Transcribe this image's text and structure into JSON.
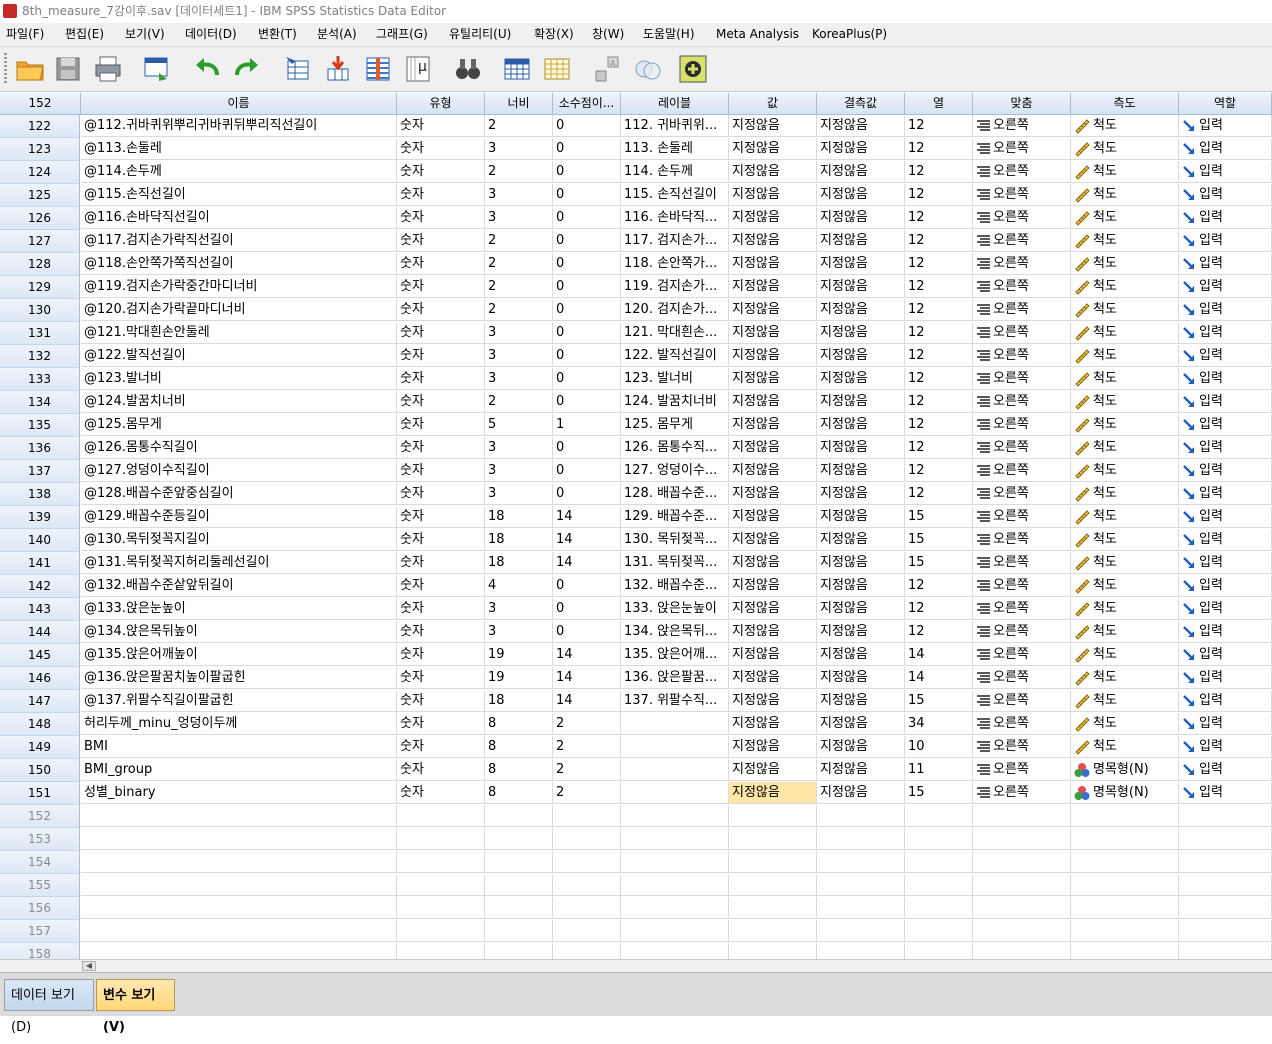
{
  "window": {
    "title": "8th_measure_7강이후.sav [데이터세트1] - IBM SPSS Statistics Data Editor",
    "accent": "#c62828"
  },
  "menu": [
    "파일(F)",
    "편집(E)",
    "보기(V)",
    "데이터(D)",
    "변환(T)",
    "분석(A)",
    "그래프(G)",
    "유틸리티(U)",
    "확장(X)",
    "창(W)",
    "도움말(H)",
    "Meta Analysis",
    "KoreaPlus(P)"
  ],
  "toolbar_icons": [
    "open-folder-icon",
    "save-icon",
    "print-icon",
    "dialog-recall-icon",
    "undo-icon",
    "redo-icon",
    "goto-case-icon",
    "goto-variable-icon",
    "variables-icon",
    "value-labels-icon",
    "find-icon",
    "split-file-icon",
    "weight-cases-icon",
    "select-cases-icon",
    "use-sets-icon",
    "add-variable-icon"
  ],
  "columns": [
    "이름",
    "유형",
    "너비",
    "소수점이...",
    "레이블",
    "값",
    "결측값",
    "열",
    "맞춤",
    "측도",
    "역할"
  ],
  "header_corner": "152",
  "rows": [
    {
      "n": "122",
      "name": "@112.귀바퀴위뿌리귀바퀴뒤뿌리직선길이",
      "type": "숫자",
      "width": "2",
      "dec": "0",
      "label": "112. 귀바퀴위...",
      "values": "지정않음",
      "missing": "지정않음",
      "cols": "12",
      "align": "오른쪽",
      "measure": "척도",
      "role": "입력"
    },
    {
      "n": "123",
      "name": "@113.손둘레",
      "type": "숫자",
      "width": "3",
      "dec": "0",
      "label": "113. 손둘레",
      "values": "지정않음",
      "missing": "지정않음",
      "cols": "12",
      "align": "오른쪽",
      "measure": "척도",
      "role": "입력"
    },
    {
      "n": "124",
      "name": "@114.손두께",
      "type": "숫자",
      "width": "2",
      "dec": "0",
      "label": "114. 손두께",
      "values": "지정않음",
      "missing": "지정않음",
      "cols": "12",
      "align": "오른쪽",
      "measure": "척도",
      "role": "입력"
    },
    {
      "n": "125",
      "name": "@115.손직선길이",
      "type": "숫자",
      "width": "3",
      "dec": "0",
      "label": "115. 손직선길이",
      "values": "지정않음",
      "missing": "지정않음",
      "cols": "12",
      "align": "오른쪽",
      "measure": "척도",
      "role": "입력"
    },
    {
      "n": "126",
      "name": "@116.손바닥직선길이",
      "type": "숫자",
      "width": "3",
      "dec": "0",
      "label": "116. 손바닥직...",
      "values": "지정않음",
      "missing": "지정않음",
      "cols": "12",
      "align": "오른쪽",
      "measure": "척도",
      "role": "입력"
    },
    {
      "n": "127",
      "name": "@117.검지손가락직선길이",
      "type": "숫자",
      "width": "2",
      "dec": "0",
      "label": "117. 검지손가...",
      "values": "지정않음",
      "missing": "지정않음",
      "cols": "12",
      "align": "오른쪽",
      "measure": "척도",
      "role": "입력"
    },
    {
      "n": "128",
      "name": "@118.손안쪽가쪽직선길이",
      "type": "숫자",
      "width": "2",
      "dec": "0",
      "label": "118. 손안쪽가...",
      "values": "지정않음",
      "missing": "지정않음",
      "cols": "12",
      "align": "오른쪽",
      "measure": "척도",
      "role": "입력"
    },
    {
      "n": "129",
      "name": "@119.검지손가락중간마디너비",
      "type": "숫자",
      "width": "2",
      "dec": "0",
      "label": "119. 검지손가...",
      "values": "지정않음",
      "missing": "지정않음",
      "cols": "12",
      "align": "오른쪽",
      "measure": "척도",
      "role": "입력"
    },
    {
      "n": "130",
      "name": "@120.검지손가락끝마디너비",
      "type": "숫자",
      "width": "2",
      "dec": "0",
      "label": "120. 검지손가...",
      "values": "지정않음",
      "missing": "지정않음",
      "cols": "12",
      "align": "오른쪽",
      "measure": "척도",
      "role": "입력"
    },
    {
      "n": "131",
      "name": "@121.막대흰손안둘레",
      "type": "숫자",
      "width": "3",
      "dec": "0",
      "label": "121. 막대흰손...",
      "values": "지정않음",
      "missing": "지정않음",
      "cols": "12",
      "align": "오른쪽",
      "measure": "척도",
      "role": "입력"
    },
    {
      "n": "132",
      "name": "@122.발직선길이",
      "type": "숫자",
      "width": "3",
      "dec": "0",
      "label": "122. 발직선길이",
      "values": "지정않음",
      "missing": "지정않음",
      "cols": "12",
      "align": "오른쪽",
      "measure": "척도",
      "role": "입력"
    },
    {
      "n": "133",
      "name": "@123.발너비",
      "type": "숫자",
      "width": "3",
      "dec": "0",
      "label": "123. 발너비",
      "values": "지정않음",
      "missing": "지정않음",
      "cols": "12",
      "align": "오른쪽",
      "measure": "척도",
      "role": "입력"
    },
    {
      "n": "134",
      "name": "@124.발꿈치너비",
      "type": "숫자",
      "width": "2",
      "dec": "0",
      "label": "124. 발꿈치너비",
      "values": "지정않음",
      "missing": "지정않음",
      "cols": "12",
      "align": "오른쪽",
      "measure": "척도",
      "role": "입력"
    },
    {
      "n": "135",
      "name": "@125.몸무게",
      "type": "숫자",
      "width": "5",
      "dec": "1",
      "label": "125. 몸무게",
      "values": "지정않음",
      "missing": "지정않음",
      "cols": "12",
      "align": "오른쪽",
      "measure": "척도",
      "role": "입력"
    },
    {
      "n": "136",
      "name": "@126.몸통수직길이",
      "type": "숫자",
      "width": "3",
      "dec": "0",
      "label": "126. 몸통수직...",
      "values": "지정않음",
      "missing": "지정않음",
      "cols": "12",
      "align": "오른쪽",
      "measure": "척도",
      "role": "입력"
    },
    {
      "n": "137",
      "name": "@127.엉덩이수직길이",
      "type": "숫자",
      "width": "3",
      "dec": "0",
      "label": "127. 엉덩이수...",
      "values": "지정않음",
      "missing": "지정않음",
      "cols": "12",
      "align": "오른쪽",
      "measure": "척도",
      "role": "입력"
    },
    {
      "n": "138",
      "name": "@128.배꼽수준앞중심길이",
      "type": "숫자",
      "width": "3",
      "dec": "0",
      "label": "128. 배꼽수준...",
      "values": "지정않음",
      "missing": "지정않음",
      "cols": "12",
      "align": "오른쪽",
      "measure": "척도",
      "role": "입력"
    },
    {
      "n": "139",
      "name": "@129.배꼽수준등길이",
      "type": "숫자",
      "width": "18",
      "dec": "14",
      "label": "129. 배꼽수준...",
      "values": "지정않음",
      "missing": "지정않음",
      "cols": "15",
      "align": "오른쪽",
      "measure": "척도",
      "role": "입력"
    },
    {
      "n": "140",
      "name": "@130.목뒤젖꼭지길이",
      "type": "숫자",
      "width": "18",
      "dec": "14",
      "label": "130. 목뒤젖꼭...",
      "values": "지정않음",
      "missing": "지정않음",
      "cols": "15",
      "align": "오른쪽",
      "measure": "척도",
      "role": "입력"
    },
    {
      "n": "141",
      "name": "@131.목뒤젖꼭지허리둘레선길이",
      "type": "숫자",
      "width": "18",
      "dec": "14",
      "label": "131. 목뒤젖꼭...",
      "values": "지정않음",
      "missing": "지정않음",
      "cols": "15",
      "align": "오른쪽",
      "measure": "척도",
      "role": "입력"
    },
    {
      "n": "142",
      "name": "@132.배꼽수준샅앞뒤길이",
      "type": "숫자",
      "width": "4",
      "dec": "0",
      "label": "132. 배꼽수준...",
      "values": "지정않음",
      "missing": "지정않음",
      "cols": "12",
      "align": "오른쪽",
      "measure": "척도",
      "role": "입력"
    },
    {
      "n": "143",
      "name": "@133.앉은눈높이",
      "type": "숫자",
      "width": "3",
      "dec": "0",
      "label": "133. 앉은눈높이",
      "values": "지정않음",
      "missing": "지정않음",
      "cols": "12",
      "align": "오른쪽",
      "measure": "척도",
      "role": "입력"
    },
    {
      "n": "144",
      "name": "@134.앉은목뒤높이",
      "type": "숫자",
      "width": "3",
      "dec": "0",
      "label": "134. 앉은목뒤...",
      "values": "지정않음",
      "missing": "지정않음",
      "cols": "12",
      "align": "오른쪽",
      "measure": "척도",
      "role": "입력"
    },
    {
      "n": "145",
      "name": "@135.앉은어깨높이",
      "type": "숫자",
      "width": "19",
      "dec": "14",
      "label": "135. 앉은어깨...",
      "values": "지정않음",
      "missing": "지정않음",
      "cols": "14",
      "align": "오른쪽",
      "measure": "척도",
      "role": "입력"
    },
    {
      "n": "146",
      "name": "@136.앉은팔꿈치높이팔굽힌",
      "type": "숫자",
      "width": "19",
      "dec": "14",
      "label": "136. 앉은팔꿈...",
      "values": "지정않음",
      "missing": "지정않음",
      "cols": "14",
      "align": "오른쪽",
      "measure": "척도",
      "role": "입력"
    },
    {
      "n": "147",
      "name": "@137.위팔수직길이팔굽힌",
      "type": "숫자",
      "width": "18",
      "dec": "14",
      "label": "137. 위팔수직...",
      "values": "지정않음",
      "missing": "지정않음",
      "cols": "15",
      "align": "오른쪽",
      "measure": "척도",
      "role": "입력"
    },
    {
      "n": "148",
      "name": "허리두께_minu_엉덩이두께",
      "type": "숫자",
      "width": "8",
      "dec": "2",
      "label": "",
      "values": "지정않음",
      "missing": "지정않음",
      "cols": "34",
      "align": "오른쪽",
      "measure": "척도",
      "role": "입력"
    },
    {
      "n": "149",
      "name": "BMI",
      "type": "숫자",
      "width": "8",
      "dec": "2",
      "label": "",
      "values": "지정않음",
      "missing": "지정않음",
      "cols": "10",
      "align": "오른쪽",
      "measure": "척도",
      "role": "입력"
    },
    {
      "n": "150",
      "name": "BMI_group",
      "type": "숫자",
      "width": "8",
      "dec": "2",
      "label": "",
      "values": "지정않음",
      "missing": "지정않음",
      "cols": "11",
      "align": "오른쪽",
      "measure": "명목형(N)",
      "role": "입력"
    },
    {
      "n": "151",
      "name": "성별_binary",
      "type": "숫자",
      "width": "8",
      "dec": "2",
      "label": "",
      "values": "지정않음",
      "missing": "지정않음",
      "cols": "15",
      "align": "오른쪽",
      "measure": "명목형(N)",
      "role": "입력",
      "selected": true
    }
  ],
  "empty_rows": [
    "152",
    "153",
    "154",
    "155",
    "156",
    "157",
    "158"
  ],
  "tabs": {
    "data_view": "데이터 보기(D)",
    "variable_view": "변수 보기(V)"
  },
  "colors": {
    "header_blue": "#d5e3f3",
    "selected_cell": "#ffe7a8",
    "active_tab": "#ffd77a"
  }
}
